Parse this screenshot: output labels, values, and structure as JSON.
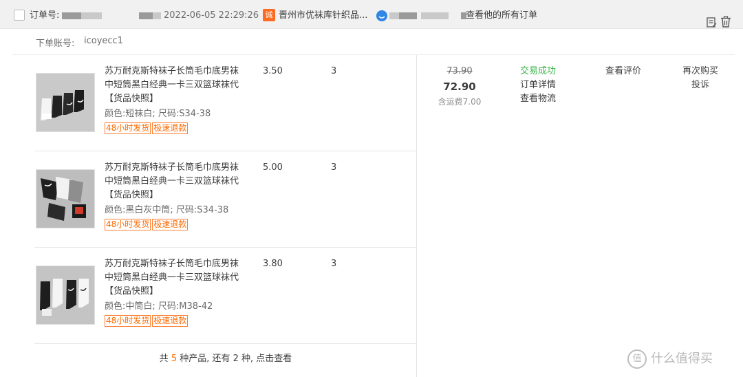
{
  "header": {
    "order_no_label": "订单号:",
    "order_date": "2022-06-05 22:29:26",
    "shop_icon": "诚",
    "shop_name": "晋州市优袜库针织品...",
    "wangwang_icon": "",
    "view_all_orders": "查看他的所有订单"
  },
  "account": {
    "label": "下单账号:",
    "value": "icoyecc1"
  },
  "items": [
    {
      "title": "苏万耐克斯特袜子长筒毛巾底男袜中短筒黑白经典一卡三双篮球袜代 【货品快照】",
      "spec": "颜色:短袜白; 尺码:S34-38",
      "tags": [
        "48小时发货",
        "极速退款"
      ],
      "price": "3.50",
      "qty": "3"
    },
    {
      "title": "苏万耐克斯特袜子长筒毛巾底男袜中短筒黑白经典一卡三双篮球袜代 【货品快照】",
      "spec": "颜色:黑白灰中筒; 尺码:S34-38",
      "tags": [
        "48小时发货",
        "极速退款"
      ],
      "price": "5.00",
      "qty": "3"
    },
    {
      "title": "苏万耐克斯特袜子长筒毛巾底男袜中短筒黑白经典一卡三双篮球袜代 【货品快照】",
      "spec": "颜色:中筒白; 尺码:M38-42",
      "tags": [
        "48小时发货",
        "极速退款"
      ],
      "price": "3.80",
      "qty": "3"
    }
  ],
  "more": {
    "prefix": "共 ",
    "total": "5",
    "mid": " 种产品, 还有 ",
    "remaining": "2",
    "suffix": " 种, 点击查看"
  },
  "summary": {
    "original_price": "73.90",
    "total_price": "72.90",
    "shipping": "含运费7.00",
    "status": "交易成功",
    "order_detail": "订单详情",
    "logistics": "查看物流",
    "view_review": "查看评价",
    "buy_again": "再次购买",
    "complain": "投诉"
  },
  "watermark": "什么值得买",
  "colors": {
    "accent_orange": "#ff6a00",
    "status_green": "#39b54a",
    "header_bg": "#f1f1f1"
  },
  "icons": [
    "checkbox",
    "shop-icon",
    "wangwang-icon",
    "memo-icon",
    "trash-icon"
  ]
}
